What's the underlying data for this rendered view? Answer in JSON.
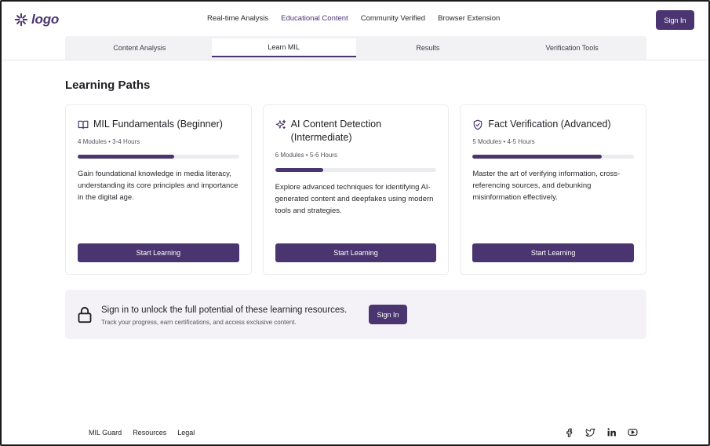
{
  "header": {
    "logo_text": "logo",
    "nav": [
      {
        "label": "Real-time Analysis",
        "active": false
      },
      {
        "label": "Educational Content",
        "active": true
      },
      {
        "label": "Community Verified",
        "active": false
      },
      {
        "label": "Browser Extension",
        "active": false
      }
    ],
    "signin_label": "Sign In"
  },
  "tabs": [
    {
      "label": "Content Analysis",
      "active": false
    },
    {
      "label": "Learn MIL",
      "active": true
    },
    {
      "label": "Results",
      "active": false
    },
    {
      "label": "Verification Tools",
      "active": false
    }
  ],
  "main": {
    "section_title": "Learning Paths",
    "cards": [
      {
        "icon": "book-icon",
        "title": "MIL Fundamentals (Beginner)",
        "meta": "4 Modules • 3-4 Hours",
        "progress": 0.6,
        "description": "Gain foundational knowledge in media literacy, understanding its core principles and importance in the digital age.",
        "button": "Start Learning"
      },
      {
        "icon": "sparkles-icon",
        "title": "AI Content Detection (Intermediate)",
        "meta": "6 Modules • 5-6 Hours",
        "progress": 0.3,
        "description": "Explore advanced techniques for identifying AI-generated content and deepfakes using modern tools and strategies.",
        "button": "Start Learning"
      },
      {
        "icon": "shield-check-icon",
        "title": "Fact Verification (Advanced)",
        "meta": "5 Modules • 4-5 Hours",
        "progress": 0.8,
        "description": "Master the art of verifying information, cross-referencing sources, and debunking misinformation effectively.",
        "button": "Start Learning"
      }
    ]
  },
  "banner": {
    "title": "Sign in to unlock the full potential of these learning resources.",
    "subtitle": "Track your progress, earn certifications, and access exclusive content.",
    "button": "Sign In"
  },
  "footer": {
    "links": [
      "MIL Guard",
      "Resources",
      "Legal"
    ],
    "social": [
      "facebook-icon",
      "twitter-icon",
      "linkedin-icon",
      "youtube-icon"
    ]
  },
  "colors": {
    "accent": "#4a3570",
    "tab_bg": "#f2f1f4",
    "banner_bg": "#f4f2f7"
  }
}
